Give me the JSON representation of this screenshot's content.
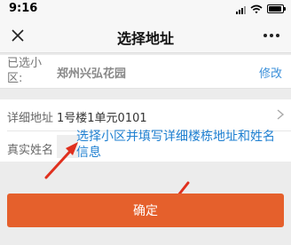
{
  "status_bar": {
    "time": "9:16",
    "icons": [
      "signal-icon",
      "wifi-icon",
      "battery-icon"
    ],
    "battery_level": 0.9
  },
  "nav": {
    "title": "选择地址",
    "close_icon": "close-icon",
    "more_icon": "more-icon"
  },
  "community": {
    "label": "已选小区:",
    "value": "郑州兴弘花园",
    "modify": "修改"
  },
  "detail": {
    "label": "详细地址",
    "value": "1号楼1单元0101",
    "chevron_icon": "chevron-right-icon"
  },
  "name": {
    "label": "真实姓名",
    "value": ""
  },
  "annotation": {
    "text": "选择小区并填写详细楼栋地址和姓名信息",
    "color": "#1e7fd0",
    "arrow_color": "#e0301e"
  },
  "confirm": {
    "label": "确定",
    "color": "#e5602c"
  }
}
